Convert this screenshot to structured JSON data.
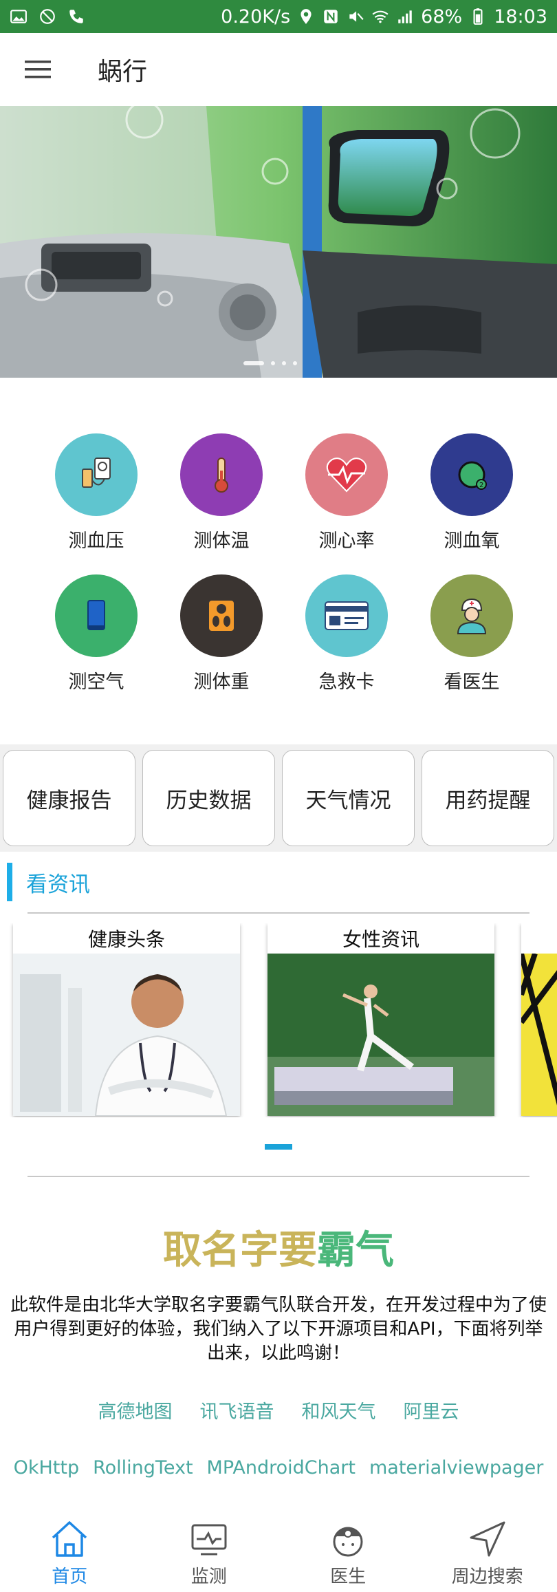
{
  "statusbar": {
    "network_speed": "0.20K/s",
    "battery": "68%",
    "time": "18:03"
  },
  "appbar": {
    "title": "蜗行"
  },
  "banner": {
    "page_count": 4,
    "active_page": 1
  },
  "measure": {
    "items": [
      {
        "label": "测血压",
        "icon": "blood-pressure-icon",
        "color": "#5fc5cf"
      },
      {
        "label": "测体温",
        "icon": "thermometer-icon",
        "color": "#8e3db3"
      },
      {
        "label": "测心率",
        "icon": "heart-rate-icon",
        "color": "#e07d86"
      },
      {
        "label": "测血氧",
        "icon": "blood-oxygen-icon",
        "color": "#2f3b8f"
      },
      {
        "label": "测空气",
        "icon": "air-quality-icon",
        "color": "#3bb06c"
      },
      {
        "label": "测体重",
        "icon": "weight-scale-icon",
        "color": "#3a3431"
      },
      {
        "label": "急救卡",
        "icon": "id-card-icon",
        "color": "#5fc5cf"
      },
      {
        "label": "看医生",
        "icon": "doctor-icon",
        "color": "#8a9e4e"
      }
    ]
  },
  "quick": {
    "buttons": [
      "健康报告",
      "历史数据",
      "天气情况",
      "用药提醒"
    ]
  },
  "news": {
    "title": "看资讯",
    "cards": [
      {
        "title": "健康头条"
      },
      {
        "title": "女性资讯"
      }
    ]
  },
  "about": {
    "brand_part1": "取名字要",
    "brand_part2": "霸气",
    "brand_color1": "#c9b45a",
    "brand_color2": "#4ab77a",
    "text": "此软件是由北华大学取名字要霸气队联合开发，在开发过程中为了使用户得到更好的体验，我们纳入了以下开源项目和API，下面将列举出来，以此鸣谢！",
    "links_row1": [
      "高德地图",
      "讯飞语音",
      "和风天气",
      "阿里云"
    ],
    "links_row2": [
      "OkHttp",
      "RollingText",
      "MPAndroidChart",
      "materialviewpager"
    ]
  },
  "bottomnav": {
    "items": [
      {
        "label": "首页",
        "icon": "home-icon"
      },
      {
        "label": "监测",
        "icon": "monitor-icon"
      },
      {
        "label": "医生",
        "icon": "doctor-face-icon"
      },
      {
        "label": "周边搜索",
        "icon": "navigation-arrow-icon"
      }
    ],
    "active_index": 0,
    "accent": "#1e88e5"
  }
}
